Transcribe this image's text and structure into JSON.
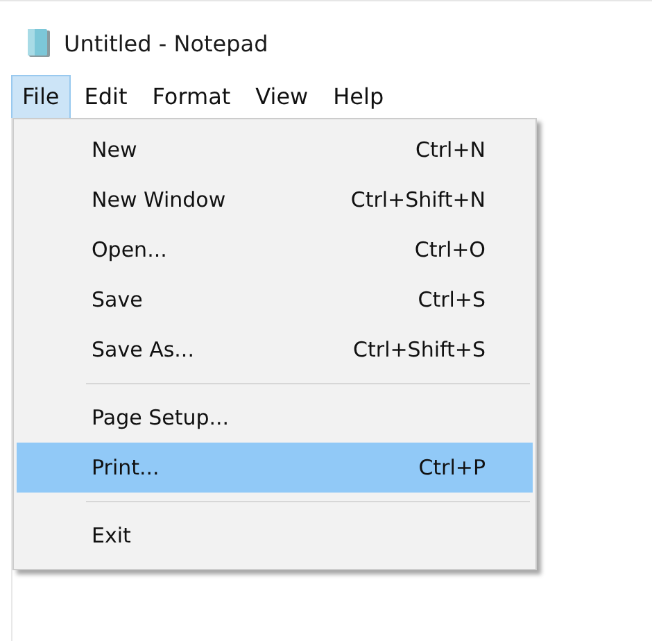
{
  "window": {
    "title": "Untitled - Notepad"
  },
  "menu_bar": [
    {
      "label": "File",
      "selected": true
    },
    {
      "label": "Edit",
      "selected": false
    },
    {
      "label": "Format",
      "selected": false
    },
    {
      "label": "View",
      "selected": false
    },
    {
      "label": "Help",
      "selected": false
    }
  ],
  "file_menu": [
    {
      "kind": "item",
      "label": "New",
      "shortcut": "Ctrl+N",
      "selected": false
    },
    {
      "kind": "item",
      "label": "New Window",
      "shortcut": "Ctrl+Shift+N",
      "selected": false
    },
    {
      "kind": "item",
      "label": "Open...",
      "shortcut": "Ctrl+O",
      "selected": false
    },
    {
      "kind": "item",
      "label": "Save",
      "shortcut": "Ctrl+S",
      "selected": false
    },
    {
      "kind": "item",
      "label": "Save As...",
      "shortcut": "Ctrl+Shift+S",
      "selected": false
    },
    {
      "kind": "separator"
    },
    {
      "kind": "item",
      "label": "Page Setup...",
      "selected": false
    },
    {
      "kind": "item",
      "label": "Print...",
      "shortcut": "Ctrl+P",
      "selected": true
    },
    {
      "kind": "separator"
    },
    {
      "kind": "item",
      "label": "Exit",
      "selected": false
    }
  ]
}
